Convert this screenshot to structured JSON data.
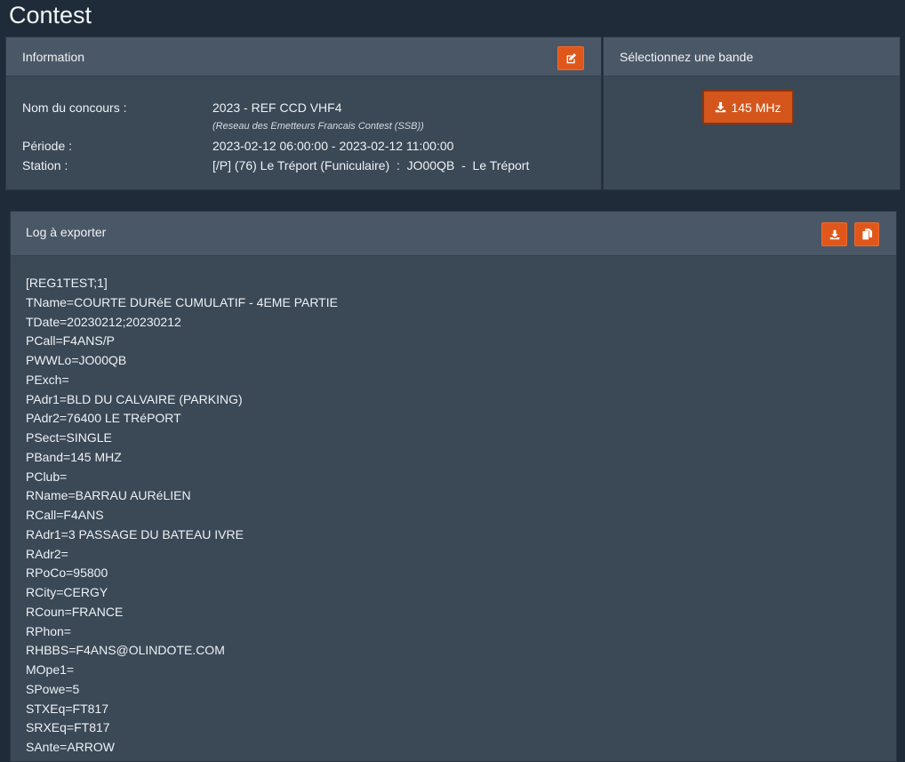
{
  "page": {
    "title": "Contest"
  },
  "info": {
    "header": "Information",
    "contest_label": "Nom du concours :",
    "contest_value": "2023 - REF CCD VHF4",
    "contest_note": "(Reseau des Emetteurs Francais Contest (SSB))",
    "period_label": "Période :",
    "period_value": "2023-02-12 06:00:00 - 2023-02-12 11:00:00",
    "station_label": "Station :",
    "station_value": "[/P] (76) Le Tréport (Funiculaire)  :  JO00QB  -  Le Tréport",
    "edit_icon": "edit-icon"
  },
  "band": {
    "header": "Sélectionnez une bande",
    "button_label": "145 MHz",
    "button_icon": "download-icon"
  },
  "log": {
    "header": "Log à exporter",
    "download_icon": "download-icon",
    "copy_icon": "copy-icon",
    "lines": [
      "[REG1TEST;1]",
      "TName=COURTE DURéE CUMULATIF - 4EME PARTIE",
      "TDate=20230212;20230212",
      "PCall=F4ANS/P",
      "PWWLo=JO00QB",
      "PExch=",
      "PAdr1=BLD DU CALVAIRE (PARKING)",
      "PAdr2=76400 LE TRéPORT",
      "PSect=SINGLE",
      "PBand=145 MHZ",
      "PClub=",
      "RName=BARRAU AURéLIEN",
      "RCall=F4ANS",
      "RAdr1=3 PASSAGE DU BATEAU IVRE",
      "RAdr2=",
      "RPoCo=95800",
      "RCity=CERGY",
      "RCoun=FRANCE",
      "RPhon=",
      "RHBBS=F4ANS@OLINDOTE.COM",
      "MOpe1=",
      "SPowe=5",
      "STXEq=FT817",
      "SRXEq=FT817",
      "SAnte=ARROW"
    ]
  },
  "colors": {
    "background": "#1f2b38",
    "panel": "#3b4856",
    "panel_header": "#4a5766",
    "accent": "#e0571b"
  }
}
